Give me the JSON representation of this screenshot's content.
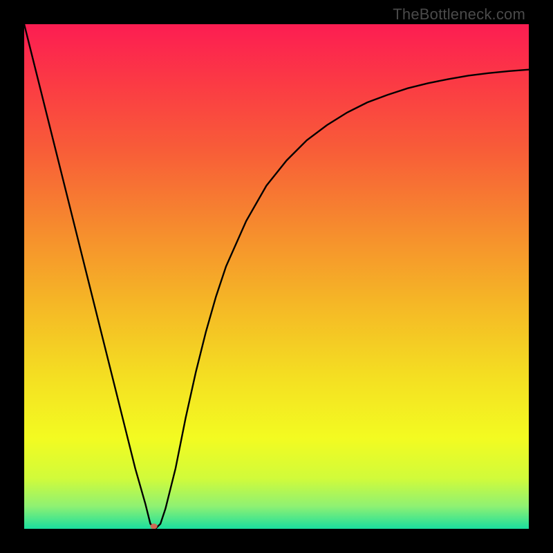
{
  "watermark": "TheBottleneck.com",
  "chart_data": {
    "type": "line",
    "title": "",
    "xlabel": "",
    "ylabel": "",
    "x_range": [
      0,
      100
    ],
    "y_range": [
      0,
      100
    ],
    "series": [
      {
        "name": "curve",
        "x": [
          0,
          2,
          4,
          6,
          8,
          10,
          12,
          14,
          16,
          18,
          20,
          22,
          24,
          25,
          26,
          27,
          28,
          30,
          32,
          34,
          36,
          38,
          40,
          44,
          48,
          52,
          56,
          60,
          64,
          68,
          72,
          76,
          80,
          84,
          88,
          92,
          96,
          100
        ],
        "y": [
          100,
          92,
          84,
          76,
          68,
          60,
          52,
          44,
          36,
          28,
          20,
          12,
          5,
          1,
          0,
          1,
          4,
          12,
          22,
          31,
          39,
          46,
          52,
          61,
          68,
          73,
          77,
          80,
          82.5,
          84.5,
          86,
          87.3,
          88.3,
          89.1,
          89.8,
          90.3,
          90.7,
          91
        ]
      }
    ],
    "marker": {
      "x": 25.7,
      "y": 0.5,
      "radius_px": 5
    },
    "gradient_stops": [
      {
        "offset": 0.0,
        "color": "#fc1d52"
      },
      {
        "offset": 0.12,
        "color": "#fb3b44"
      },
      {
        "offset": 0.25,
        "color": "#f85d38"
      },
      {
        "offset": 0.4,
        "color": "#f68a2e"
      },
      {
        "offset": 0.55,
        "color": "#f5b626"
      },
      {
        "offset": 0.7,
        "color": "#f4df22"
      },
      {
        "offset": 0.82,
        "color": "#f3fb21"
      },
      {
        "offset": 0.9,
        "color": "#d1fb3a"
      },
      {
        "offset": 0.955,
        "color": "#8ff172"
      },
      {
        "offset": 1.0,
        "color": "#1adf9e"
      }
    ]
  }
}
